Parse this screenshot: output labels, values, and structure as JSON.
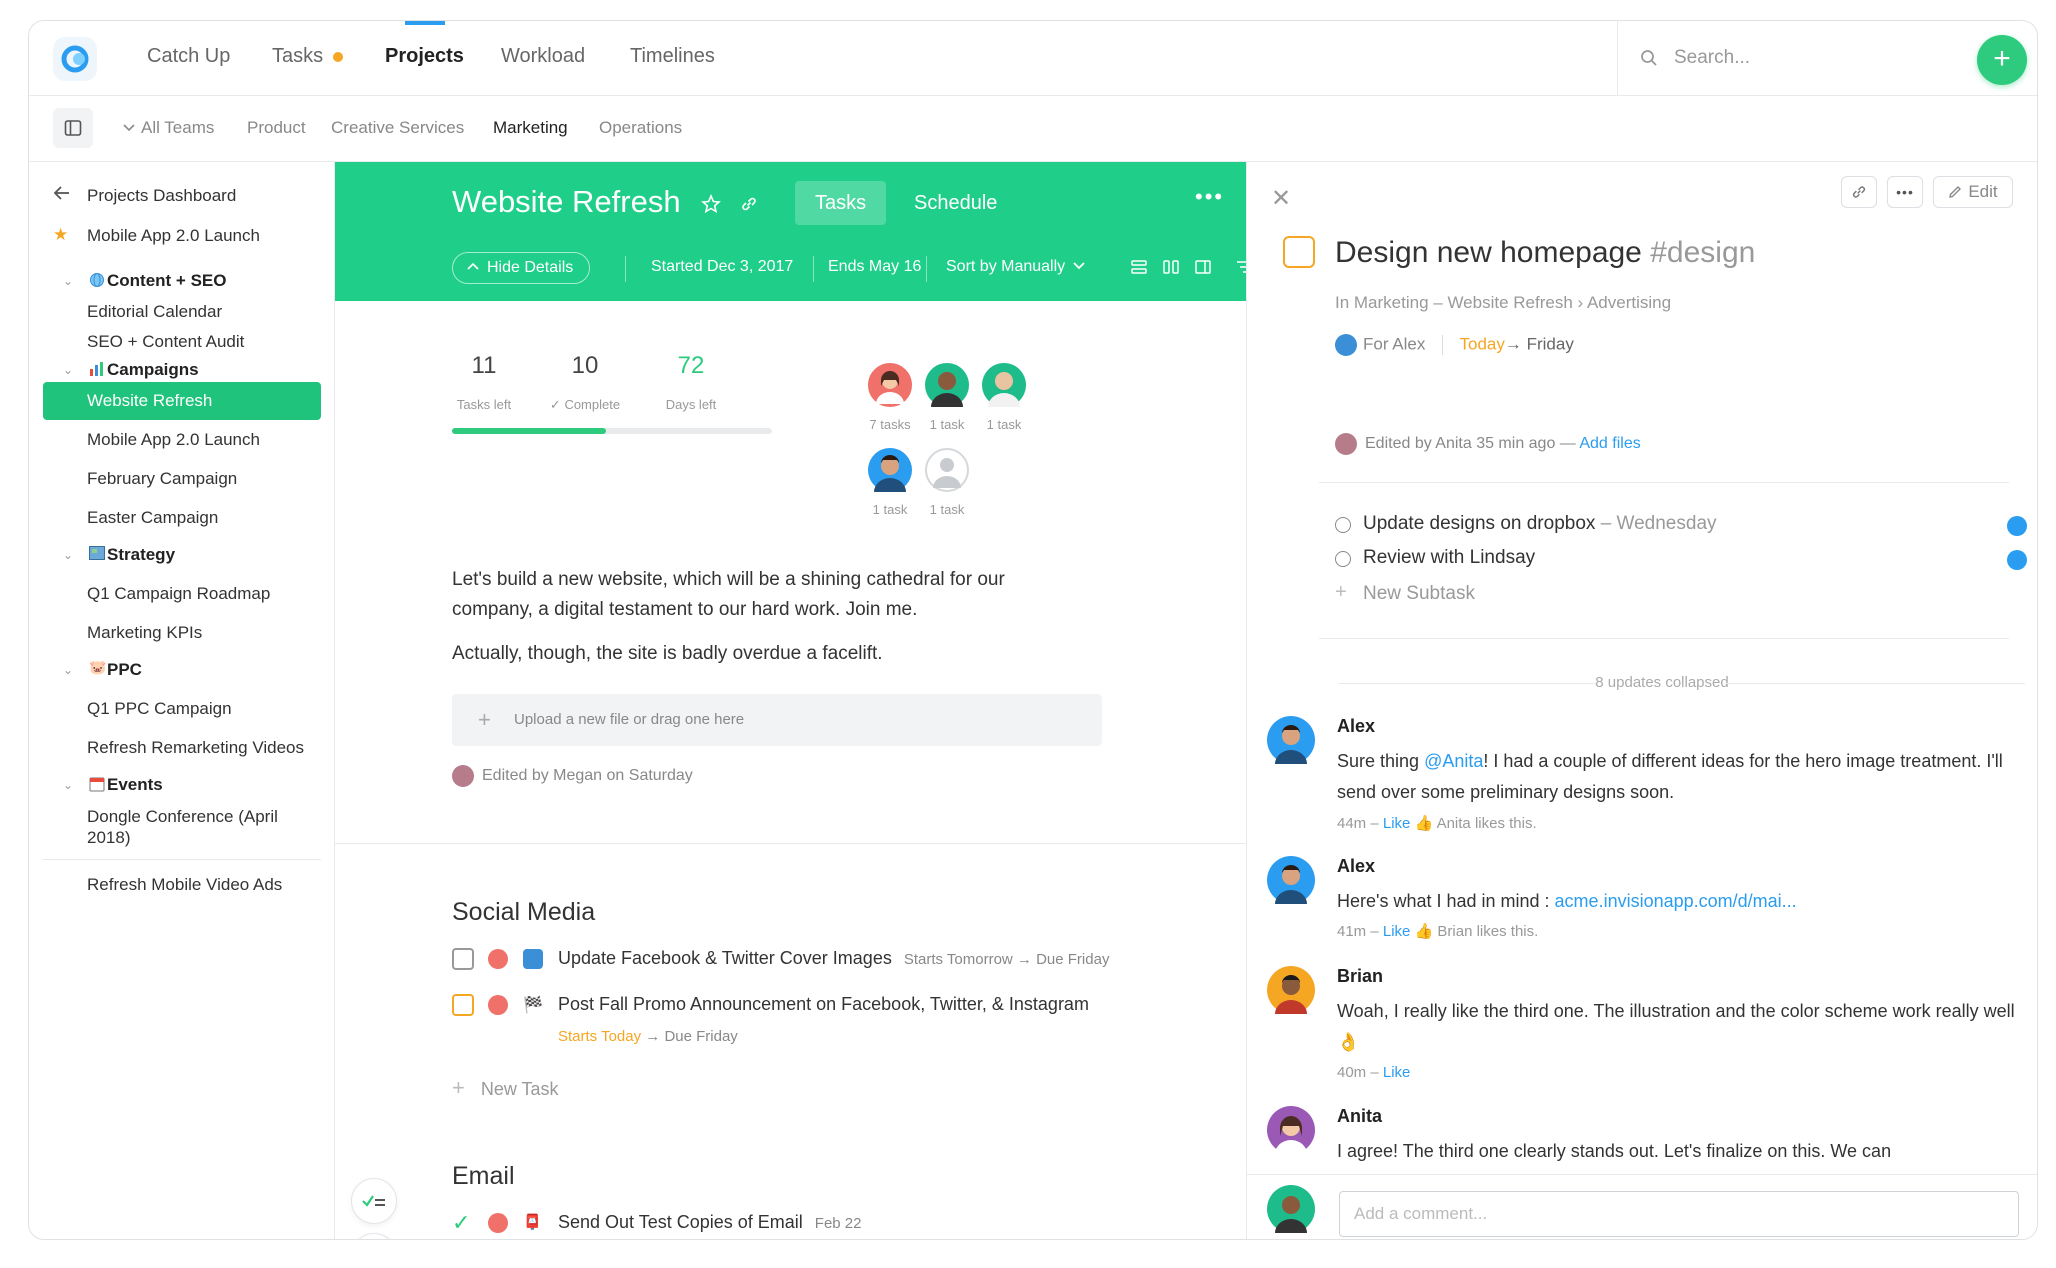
{
  "nav": {
    "tabs": [
      "Catch Up",
      "Tasks",
      "Projects",
      "Workload",
      "Timelines"
    ],
    "search_placeholder": "Search...",
    "add_label": "+"
  },
  "teams": [
    "All Teams",
    "Product",
    "Creative Services",
    "Marketing",
    "Operations"
  ],
  "sidebar": {
    "back": "Projects Dashboard",
    "starred": "Mobile App 2.0 Launch",
    "items": [
      "Content + SEO",
      "Editorial Calendar",
      "SEO + Content Audit",
      "Campaigns",
      "Website Refresh",
      "Mobile App 2.0 Launch",
      "February Campaign",
      "Easter Campaign",
      "Strategy",
      "Q1 Campaign Roadmap",
      "Marketing KPIs",
      "PPC",
      "Q1 PPC Campaign",
      "Refresh Remarketing Videos",
      "Events",
      "Dongle Conference (April 2018)",
      "Refresh Mobile Video Ads"
    ]
  },
  "project": {
    "title": "Website Refresh",
    "tabs": [
      "Tasks",
      "Schedule"
    ],
    "hide_details": "Hide Details",
    "started": "Started Dec 3, 2017",
    "ends": "Ends May 16",
    "sort": "Sort by Manually",
    "stats": [
      {
        "num": "11",
        "label": "Tasks left"
      },
      {
        "num": "10",
        "label": "Complete"
      },
      {
        "num": "72",
        "label": "Days left"
      }
    ],
    "progress_fraction": 0.48,
    "members": [
      "7 tasks",
      "1 task",
      "1 task",
      "1 task",
      "1 task"
    ],
    "description": [
      "Let's build a new website, which will be a shining cathedral for our company, a digital testament to our hard work. Join me.",
      "Actually, though, the site is badly overdue a facelift."
    ],
    "upload": "Upload a new file or drag one here",
    "edited": "Edited by Megan on Saturday",
    "sections": [
      {
        "title": "Social Media",
        "tasks": [
          {
            "name": "Update Facebook & Twitter Cover Images",
            "due": "Starts Tomorrow → Due Friday"
          },
          {
            "name": "Post Fall Promo Announcement on Facebook, Twitter, & Instagram",
            "starts": "Starts Today",
            "due": "→ Due Friday"
          }
        ],
        "new_task": "New Task"
      },
      {
        "title": "Email",
        "tasks": [
          {
            "name": "Send Out Test Copies of Email",
            "due": "Feb 22"
          }
        ]
      }
    ]
  },
  "detail": {
    "edit": "Edit",
    "title": "Design new homepage",
    "tag": "#design",
    "breadcrumb": "In Marketing – Website Refresh › Advertising",
    "for": "For Alex",
    "today": "Today",
    "arrow_friday": "→ Friday",
    "edited": "Edited by Anita 35 min ago — ",
    "add_files": "Add files",
    "subtasks": [
      {
        "name": "Update designs on dropbox",
        "when": " – Wednesday"
      },
      {
        "name": "Review with Lindsay",
        "when": ""
      }
    ],
    "new_subtask": "New Subtask",
    "collapsed": "8 updates collapsed",
    "comments": [
      {
        "who": "Alex",
        "pre": "Sure thing ",
        "mention": "@Anita",
        "text": "! I had a couple of different ideas for the hero image treatment. I'll send over some preliminary designs soon.",
        "time": "44m – ",
        "like": "Like",
        "likes": " Anita likes this."
      },
      {
        "who": "Alex",
        "pre": "Here's what I had in mind : ",
        "mention": "acme.invisionapp.com/d/mai...",
        "text": "",
        "time": "41m – ",
        "like": "Like",
        "likes": " Brian likes this."
      },
      {
        "who": "Brian",
        "pre": "",
        "mention": "",
        "text": "Woah, I really like the third one. The illustration and the color scheme work really well 👌",
        "time": "40m – ",
        "like": "Like",
        "likes": ""
      },
      {
        "who": "Anita",
        "pre": "",
        "mention": "",
        "text": "I agree! The third one clearly stands out. Let's finalize on this. We can",
        "time": "",
        "like": "",
        "likes": ""
      }
    ],
    "comment_placeholder": "Add a comment..."
  },
  "colors": {
    "accent_green": "#1fcf89",
    "link_blue": "#2b9df0",
    "warning_orange": "#f5a623"
  }
}
